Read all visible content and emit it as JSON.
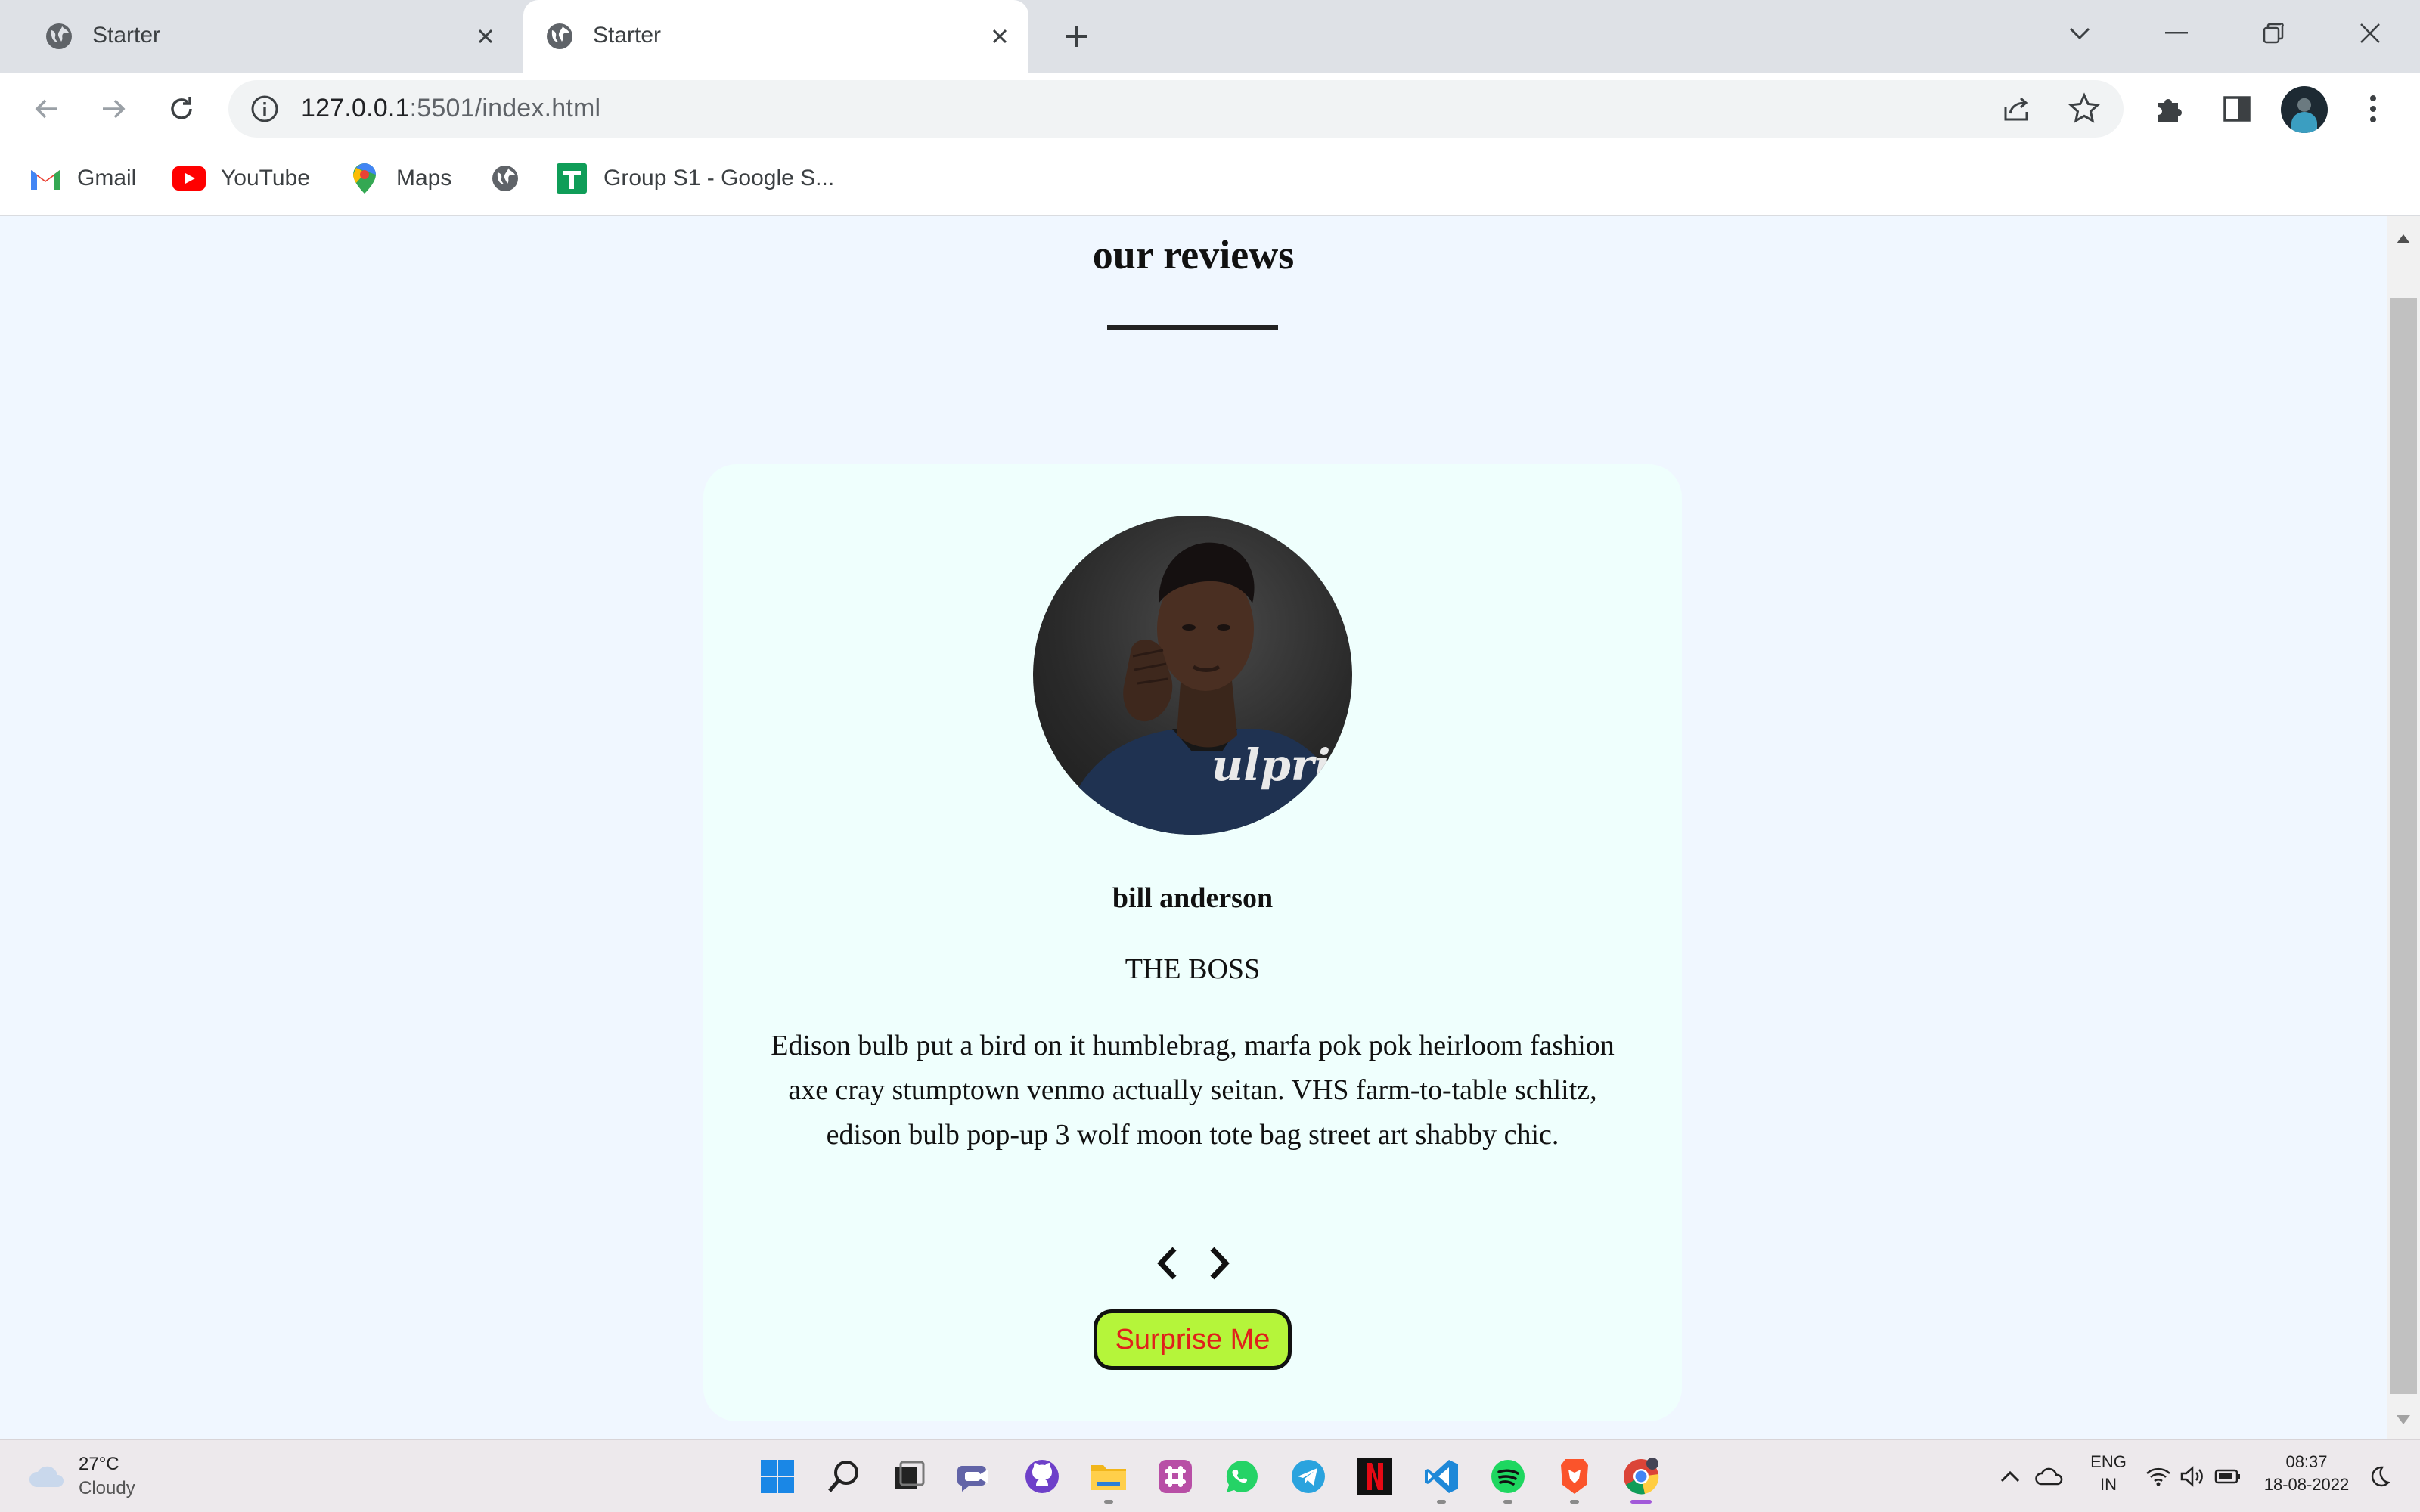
{
  "browser": {
    "tabs": [
      {
        "title": "Starter",
        "active": false
      },
      {
        "title": "Starter",
        "active": true
      }
    ],
    "url": {
      "host": "127.0.0.1",
      "path": ":5501/index.html"
    },
    "bookmarks": [
      {
        "label": "Gmail",
        "icon": "gmail-icon"
      },
      {
        "label": "YouTube",
        "icon": "youtube-icon"
      },
      {
        "label": "Maps",
        "icon": "maps-icon"
      },
      {
        "label": "",
        "icon": "globe-icon"
      },
      {
        "label": "Group S1 - Google S...",
        "icon": "sheets-icon"
      }
    ]
  },
  "page": {
    "heading": "our reviews",
    "review": {
      "name": "bill anderson",
      "job": "THE BOSS",
      "text": "Edison bulb put a bird on it humblebrag, marfa pok pok heirloom fashion axe cray stumptown venmo actually seitan. VHS farm-to-table schlitz, edison bulb pop-up 3 wolf moon tote bag street art shabby chic.",
      "portrait_shirt_text": "Culprit"
    },
    "surprise_label": "Surprise Me",
    "colors": {
      "page_bg": "#f0f7ff",
      "card_bg": "#effffd",
      "button_bg": "#b5f53a",
      "button_text": "#e0201b"
    }
  },
  "taskbar": {
    "weather": {
      "temp": "27°C",
      "condition": "Cloudy"
    },
    "apps": [
      "windows-start-icon",
      "search-icon",
      "task-view-icon",
      "teams-chat-icon",
      "github-icon",
      "file-explorer-icon",
      "slack-icon",
      "whatsapp-icon",
      "telegram-icon",
      "netflix-icon",
      "vscode-icon",
      "spotify-icon",
      "brave-icon",
      "chrome-icon"
    ],
    "language": {
      "line1": "ENG",
      "line2": "IN"
    },
    "clock": {
      "time": "08:37",
      "date": "18-08-2022"
    }
  }
}
